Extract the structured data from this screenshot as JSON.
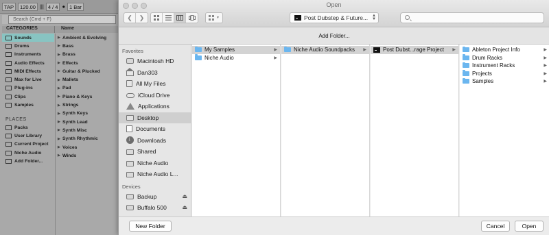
{
  "ableton": {
    "transport": {
      "tap": "TAP",
      "tempo": "120.00",
      "signature": "4 / 4",
      "rec_label": "●",
      "quantize": "1 Bar"
    },
    "search_placeholder": "Search (Cmd + F)",
    "categories_header": "CATEGORIES",
    "name_header": "Name",
    "categories": [
      "Sounds",
      "Drums",
      "Instruments",
      "Audio Effects",
      "MIDI Effects",
      "Max for Live",
      "Plug-ins",
      "Clips",
      "Samples"
    ],
    "places_header": "PLACES",
    "places": [
      "Packs",
      "User Library",
      "Current Project",
      "Niche Audio",
      "Add Folder..."
    ],
    "names": [
      "Ambient & Evolving",
      "Bass",
      "Brass",
      "Effects",
      "Guitar & Plucked",
      "Mallets",
      "Pad",
      "Piano & Keys",
      "Strings",
      "Synth Keys",
      "Synth Lead",
      "Synth Misc",
      "Synth Rhythmic",
      "Voices",
      "Winds"
    ]
  },
  "dialog": {
    "title": "Open",
    "path_popup": "Post Dubstep & Future...",
    "add_folder": "Add Folder...",
    "sidebar": {
      "favorites_header": "Favorites",
      "favorites": [
        {
          "label": "Macintosh HD",
          "icon": "hard-drive-icon"
        },
        {
          "label": "Dan303",
          "icon": "home-icon"
        },
        {
          "label": "All My Files",
          "icon": "all-files-icon"
        },
        {
          "label": "iCloud Drive",
          "icon": "cloud-icon"
        },
        {
          "label": "Applications",
          "icon": "applications-icon"
        },
        {
          "label": "Desktop",
          "icon": "desktop-icon"
        },
        {
          "label": "Documents",
          "icon": "document-icon"
        },
        {
          "label": "Downloads",
          "icon": "download-icon"
        },
        {
          "label": "Shared",
          "icon": "folder-icon"
        },
        {
          "label": "Niche Audio",
          "icon": "folder-icon"
        },
        {
          "label": "Niche Audio L...",
          "icon": "folder-icon"
        }
      ],
      "devices_header": "Devices",
      "devices": [
        {
          "label": "Backup",
          "icon": "hard-drive-icon"
        },
        {
          "label": "Buffalo 500",
          "icon": "hard-drive-icon"
        }
      ]
    },
    "columns": [
      {
        "items": [
          {
            "label": "My Samples",
            "selected": true
          },
          {
            "label": "Niche Audio",
            "selected": false
          }
        ]
      },
      {
        "items": [
          {
            "label": "Niche Audio Soundpacks",
            "selected": true
          }
        ]
      },
      {
        "items": [
          {
            "label": "Post Dubst...rage Project",
            "selected": true,
            "project": true
          }
        ]
      },
      {
        "items": [
          {
            "label": "Ableton Project Info"
          },
          {
            "label": "Drum Racks"
          },
          {
            "label": "Instrument Racks"
          },
          {
            "label": "Projects"
          },
          {
            "label": "Samples"
          }
        ]
      }
    ],
    "buttons": {
      "new_folder": "New Folder",
      "cancel": "Cancel",
      "open": "Open"
    }
  }
}
